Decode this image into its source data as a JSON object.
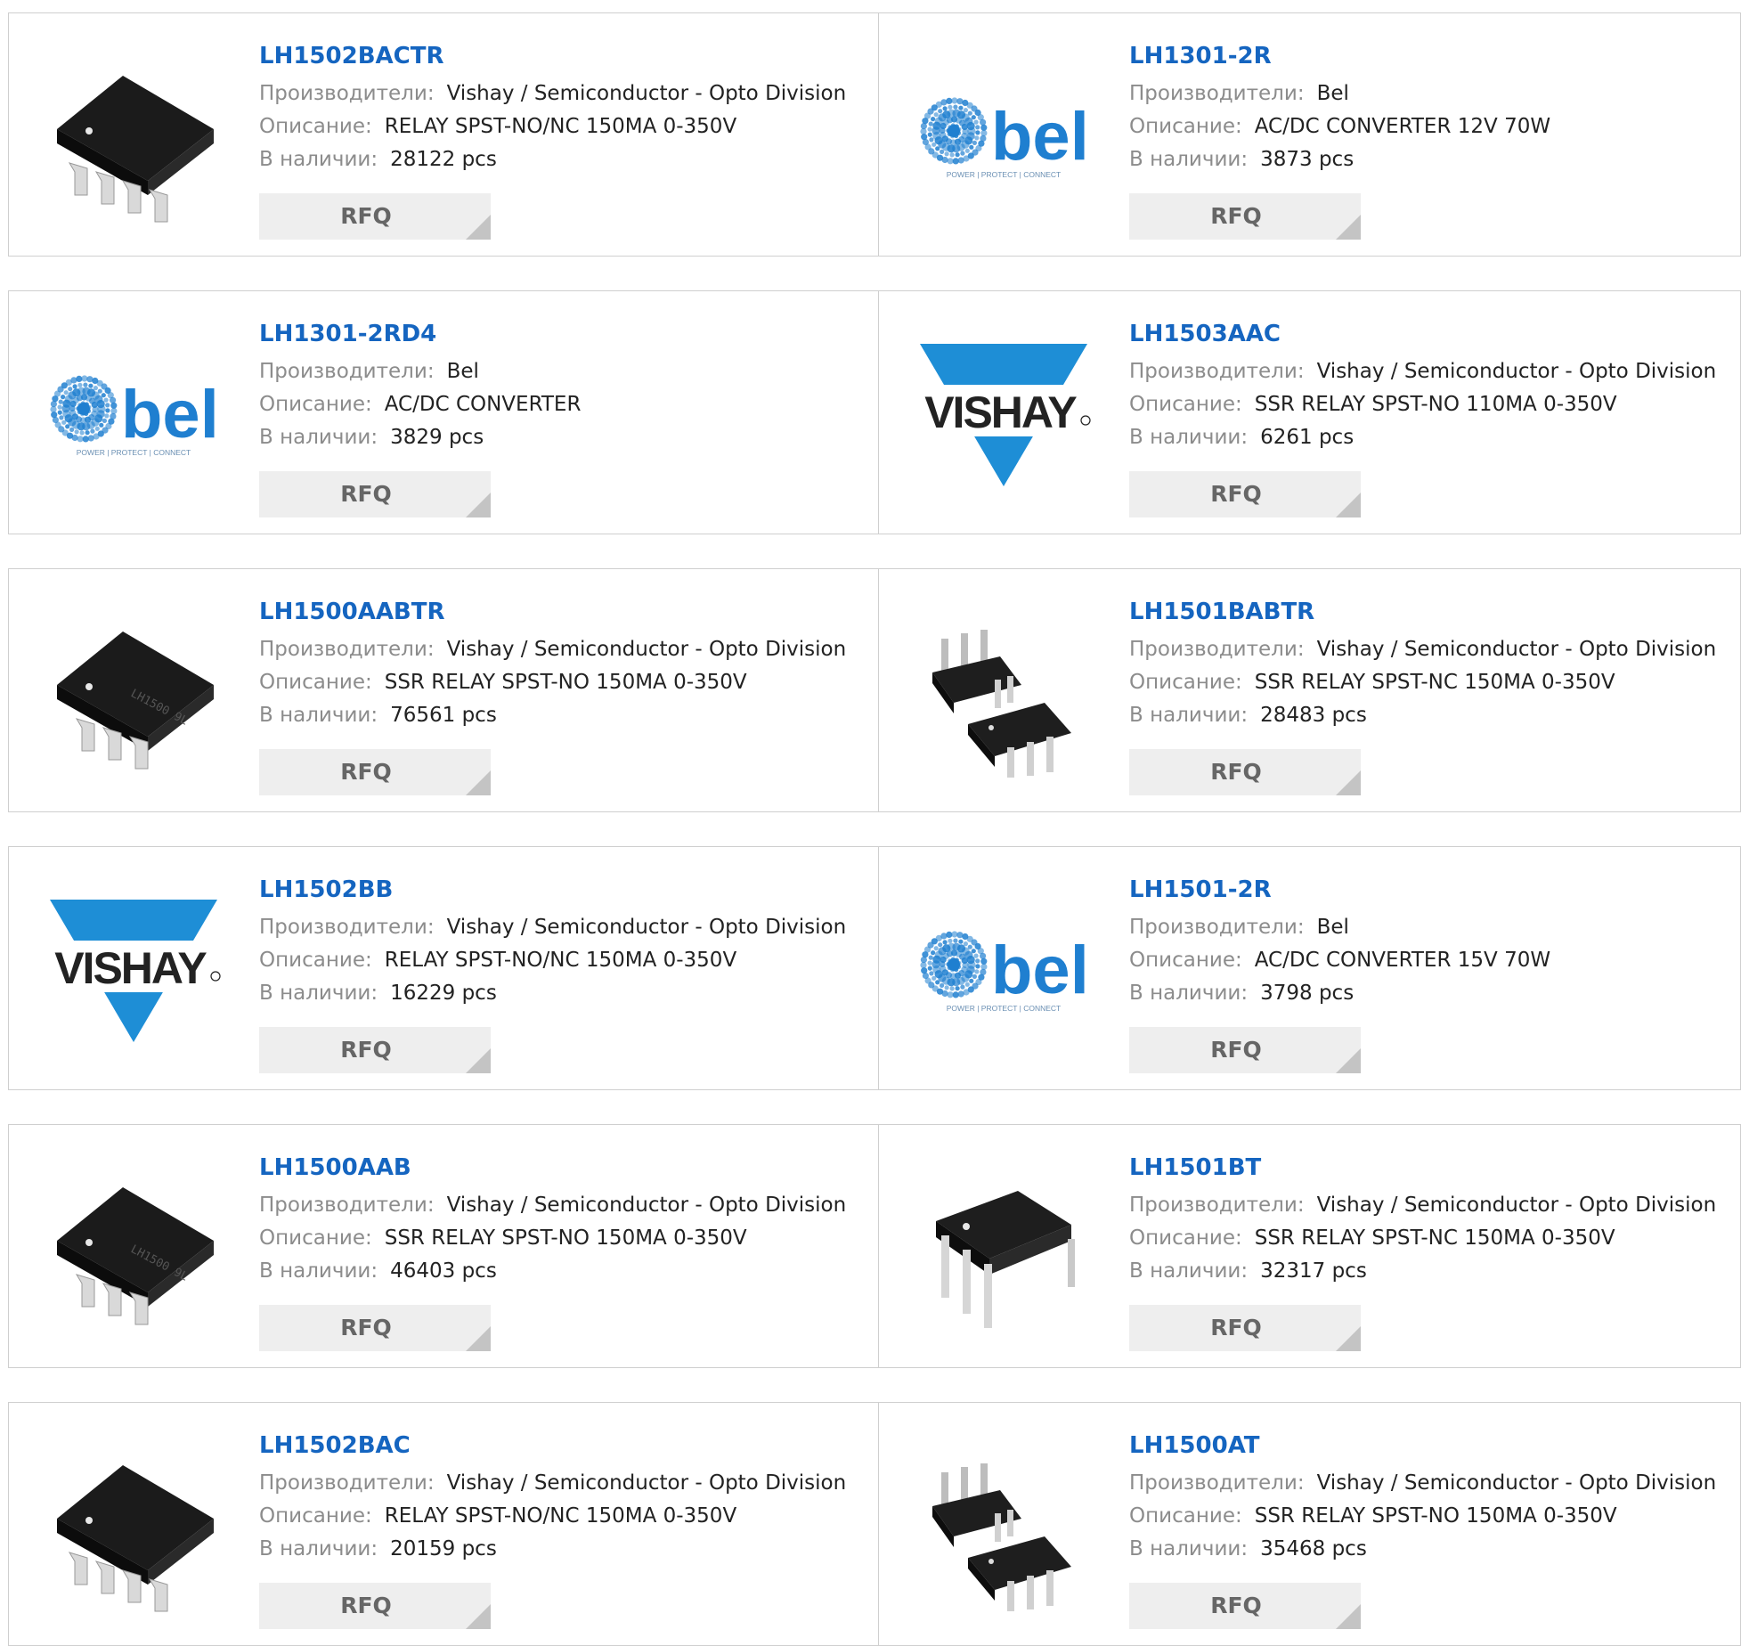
{
  "labels": {
    "manufacturer": "Производители:",
    "description": "Описание:",
    "stock": "В наличии:",
    "rfq": "RFQ"
  },
  "colors": {
    "link": "#1565c0",
    "label": "#8c8c8c",
    "vishay_blue": "#1e8ed6",
    "bel_blue": "#1f7fd0"
  },
  "products": [
    {
      "part": "LH1502BACTR",
      "manufacturer": "Vishay / Semiconductor - Opto Division",
      "description": "RELAY SPST-NO/NC 150MA 0-350V",
      "stock": "28122 pcs",
      "image": "smd-chip-8pin"
    },
    {
      "part": "LH1301-2R",
      "manufacturer": "Bel",
      "description": "AC/DC CONVERTER 12V 70W",
      "stock": "3873 pcs",
      "image": "bel-logo"
    },
    {
      "part": "LH1301-2RD4",
      "manufacturer": "Bel",
      "description": "AC/DC CONVERTER",
      "stock": "3829 pcs",
      "image": "bel-logo"
    },
    {
      "part": "LH1503AAC",
      "manufacturer": "Vishay / Semiconductor - Opto Division",
      "description": "SSR RELAY SPST-NO 110MA 0-350V",
      "stock": "6261 pcs",
      "image": "vishay-logo"
    },
    {
      "part": "LH1500AABTR",
      "manufacturer": "Vishay / Semiconductor - Opto Division",
      "description": "SSR RELAY SPST-NO 150MA 0-350V",
      "stock": "76561 pcs",
      "image": "smd-chip-6pin"
    },
    {
      "part": "LH1501BABTR",
      "manufacturer": "Vishay / Semiconductor - Opto Division",
      "description": "SSR RELAY SPST-NC 150MA 0-350V",
      "stock": "28483 pcs",
      "image": "dip-chip-pair"
    },
    {
      "part": "LH1502BB",
      "manufacturer": "Vishay / Semiconductor - Opto Division",
      "description": "RELAY SPST-NO/NC 150MA 0-350V",
      "stock": "16229 pcs",
      "image": "vishay-logo"
    },
    {
      "part": "LH1501-2R",
      "manufacturer": "Bel",
      "description": "AC/DC CONVERTER 15V 70W",
      "stock": "3798 pcs",
      "image": "bel-logo"
    },
    {
      "part": "LH1500AAB",
      "manufacturer": "Vishay / Semiconductor - Opto Division",
      "description": "SSR RELAY SPST-NO 150MA 0-350V",
      "stock": "46403 pcs",
      "image": "smd-chip-6pin"
    },
    {
      "part": "LH1501BT",
      "manufacturer": "Vishay / Semiconductor - Opto Division",
      "description": "SSR RELAY SPST-NC 150MA 0-350V",
      "stock": "32317 pcs",
      "image": "dip-chip-single"
    },
    {
      "part": "LH1502BAC",
      "manufacturer": "Vishay / Semiconductor - Opto Division",
      "description": "RELAY SPST-NO/NC 150MA 0-350V",
      "stock": "20159 pcs",
      "image": "smd-chip-8pin"
    },
    {
      "part": "LH1500AT",
      "manufacturer": "Vishay / Semiconductor - Opto Division",
      "description": "SSR RELAY SPST-NO 150MA 0-350V",
      "stock": "35468 pcs",
      "image": "dip-chip-pair"
    }
  ],
  "logo_text": {
    "bel_word": "bel",
    "bel_tagline": "POWER | PROTECT | CONNECT",
    "vishay_word": "VISHAY"
  }
}
